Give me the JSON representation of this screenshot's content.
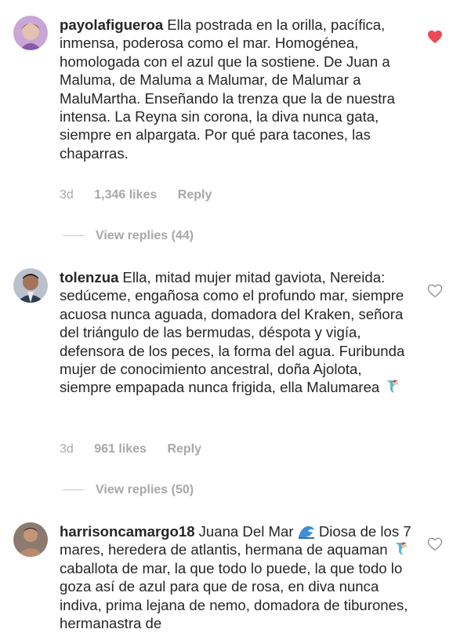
{
  "comments": [
    {
      "username": "payolafigueroa",
      "text": "Ella postrada en la orilla, pacífica, inmensa, poderosa como el mar. Homogénea, homologada con el azul que la sostiene. De Juan a Maluma, de Maluma a Malumar, de Malumar a MaluMartha. Enseñando la trenza que la de nuestra intensa. La Reyna sin corona, la diva nunca gata, siempre en alpargata. Por qué para tacones, las chaparras.",
      "time": "3d",
      "likes": "1,346 likes",
      "reply": "Reply",
      "view_replies": "View replies (44)",
      "liked": true,
      "heart_color": "#ed4956"
    },
    {
      "username": "tolenzua",
      "text": "Ella, mitad mujer mitad gaviota, Nereida: sedúceme, engañosa como el profundo mar, siempre acuosa nunca aguada, domadora del Kraken, señora del triángulo de las bermudas, déspota y vigía, defensora de los peces, la forma del agua. Furibunda mujer de conocimiento ancestral, doña Ajolota, siempre empapada nunca frigida, ella Malumarea",
      "emoji": "mermaid-emoji",
      "time": "3d",
      "likes": "961 likes",
      "reply": "Reply",
      "view_replies": "View replies (50)",
      "liked": false
    },
    {
      "username": "harrisoncamargo18",
      "text_part1": "Juana Del Mar",
      "emoji1": "wave-emoji",
      "text_part2": "Diosa de los 7 mares, heredera de atlantis, hermana de aquaman",
      "emoji2": "mermaid-emoji",
      "text_part3": "caballota de mar, la que todo lo puede, la que todo lo goza así de azul para que de rosa, en diva nunca indiva, prima lejana de nemo, domadora de tiburones, hermanastra de",
      "liked": false
    }
  ]
}
